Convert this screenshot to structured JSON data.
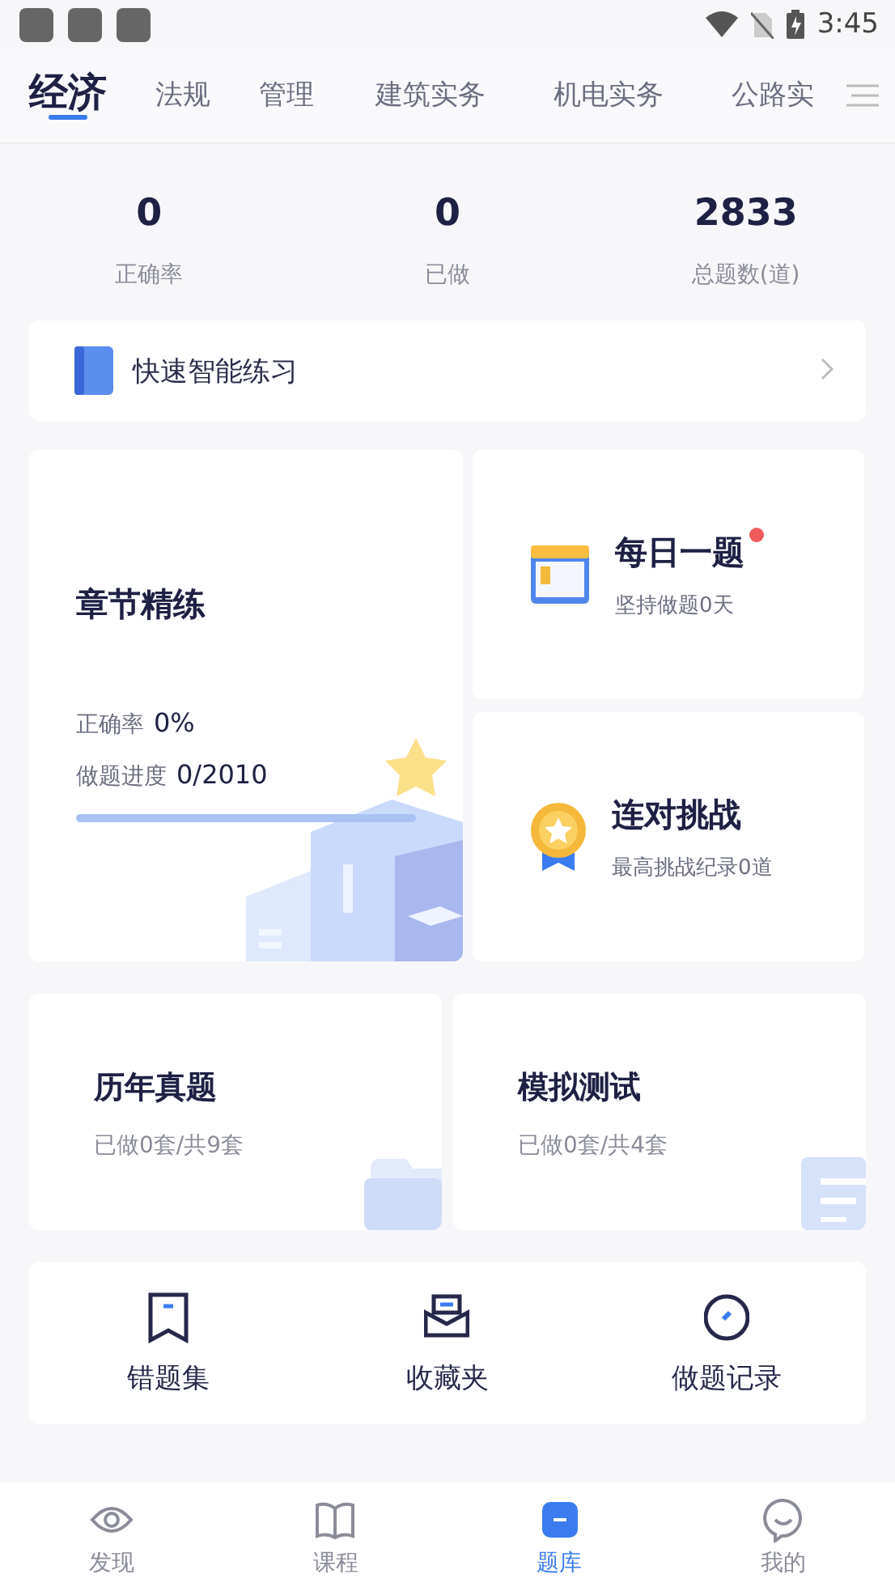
{
  "status_bar": {
    "time": "3:45"
  },
  "tabs": [
    {
      "label": "经济",
      "selected": true
    },
    {
      "label": "法规",
      "selected": false
    },
    {
      "label": "管理",
      "selected": false
    },
    {
      "label": "建筑实务",
      "selected": false
    },
    {
      "label": "机电实务",
      "selected": false
    },
    {
      "label": "公路实",
      "selected": false
    }
  ],
  "stats": [
    {
      "value": "0",
      "label": "正确率"
    },
    {
      "value": "0",
      "label": "已做"
    },
    {
      "value": "2833",
      "label": "总题数(道)"
    }
  ],
  "quick_practice": {
    "title": "快速智能练习"
  },
  "chapter_card": {
    "title": "章节精练",
    "accuracy_label": "正确率",
    "accuracy": "0%",
    "progress_label": "做题进度",
    "progress": "0/2010",
    "level": 0
  },
  "daily_card": {
    "title": "每日一题",
    "subtitle": "坚持做题0天",
    "unread": true
  },
  "streak_card": {
    "title": "连对挑战",
    "subtitle": "最高挑战纪录0道"
  },
  "paper_cards": [
    {
      "kind": "folder",
      "title": "历年真题",
      "subtitle": "已做0套/共9套"
    },
    {
      "kind": "document",
      "title": "模拟测试",
      "subtitle": "已做0套/共4套"
    }
  ],
  "tools": [
    {
      "kind": "bookmark",
      "label": "错题集"
    },
    {
      "kind": "inbox",
      "label": "收藏夹"
    },
    {
      "kind": "clock",
      "label": "做题记录"
    }
  ],
  "bottom_nav": [
    {
      "kind": "eye",
      "label": "发现",
      "selected": false
    },
    {
      "kind": "book",
      "label": "课程",
      "selected": false
    },
    {
      "kind": "bank",
      "label": "题库",
      "selected": true
    },
    {
      "kind": "smile",
      "label": "我的",
      "selected": false
    }
  ]
}
